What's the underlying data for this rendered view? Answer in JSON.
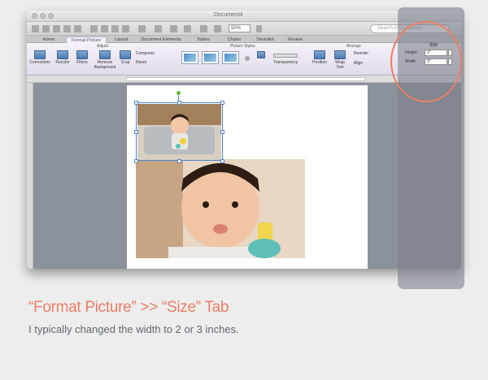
{
  "window": {
    "title": "Document4",
    "zoom": "50%",
    "search_placeholder": "Search in Document"
  },
  "tabs": [
    {
      "label": "Home"
    },
    {
      "label": "Format Picture",
      "active": true
    },
    {
      "label": "Layout"
    },
    {
      "label": "Document Elements"
    },
    {
      "label": "Tables"
    },
    {
      "label": "Charts"
    },
    {
      "label": "SmartArt"
    },
    {
      "label": "Review"
    }
  ],
  "ribbon": {
    "groups": {
      "adjust": "Adjust",
      "picture_styles": "Picture Styles",
      "arrange": "Arrange",
      "size": "Size"
    },
    "buttons": {
      "corrections": "Corrections",
      "recolor": "Recolor",
      "filters": "Filters",
      "remove_background": "Remove Background",
      "crop": "Crop",
      "compress": "Compress",
      "reset": "Reset",
      "transparency": "Transparency",
      "position": "Position",
      "wrap_text": "Wrap Text",
      "reorder": "Reorder",
      "align": "Align"
    },
    "size": {
      "height_label": "Height:",
      "height_value": "2\"",
      "width_label": "Width:",
      "width_value": "3\""
    }
  },
  "caption": {
    "title": "“Format Picture” >> “Size” Tab",
    "subtitle": "I typically changed the width to 2 or 3 inches."
  },
  "colors": {
    "caption_title": "#e97f66",
    "highlight_ring": "#ee7e65",
    "selection": "#4c84c8"
  }
}
